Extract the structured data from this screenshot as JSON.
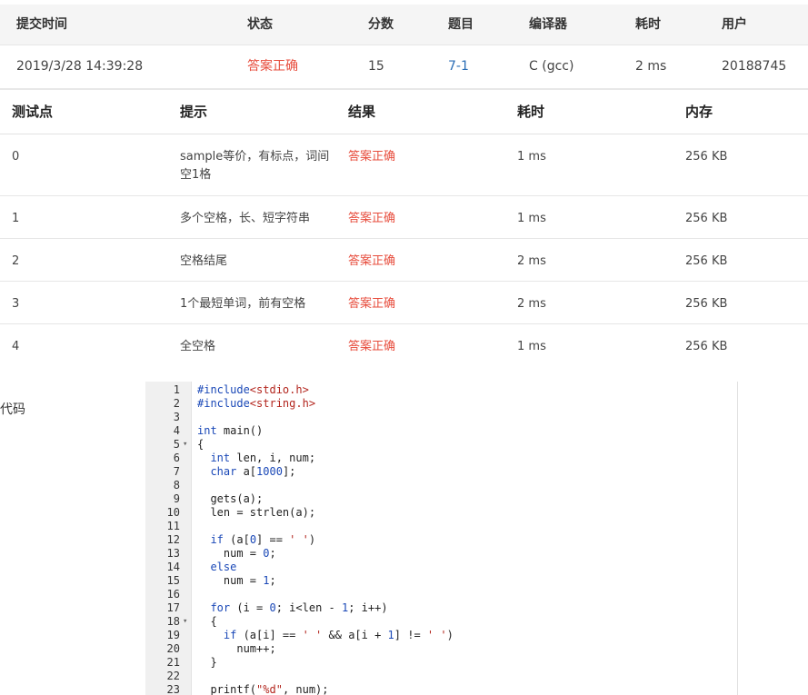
{
  "summary": {
    "headers": {
      "time": "提交时间",
      "status": "状态",
      "score": "分数",
      "problem": "题目",
      "compiler": "编译器",
      "elapsed": "耗时",
      "user": "用户"
    },
    "row": {
      "time": "2019/3/28 14:39:28",
      "status": "答案正确",
      "score": "15",
      "problem": "7-1",
      "compiler": "C (gcc)",
      "elapsed": "2 ms",
      "user": "20188745"
    }
  },
  "cases": {
    "headers": {
      "id": "测试点",
      "hint": "提示",
      "result": "结果",
      "time": "耗时",
      "memory": "内存"
    },
    "rows": [
      {
        "id": "0",
        "hint": "sample等价，有标点，词间空1格",
        "result": "答案正确",
        "time": "1 ms",
        "memory": "256 KB"
      },
      {
        "id": "1",
        "hint": "多个空格，长、短字符串",
        "result": "答案正确",
        "time": "1 ms",
        "memory": "256 KB"
      },
      {
        "id": "2",
        "hint": "空格结尾",
        "result": "答案正确",
        "time": "2 ms",
        "memory": "256 KB"
      },
      {
        "id": "3",
        "hint": "1个最短单词，前有空格",
        "result": "答案正确",
        "time": "2 ms",
        "memory": "256 KB"
      },
      {
        "id": "4",
        "hint": "全空格",
        "result": "答案正确",
        "time": "1 ms",
        "memory": "256 KB"
      }
    ]
  },
  "code": {
    "label": "代码",
    "lines": [
      "#include<stdio.h>",
      "#include<string.h>",
      "",
      "int main()",
      "{",
      "  int len, i, num;",
      "  char a[1000];",
      "",
      "  gets(a);",
      "  len = strlen(a);",
      "",
      "  if (a[0] == ' ')",
      "    num = 0;",
      "  else",
      "    num = 1;",
      "",
      "  for (i = 0; i<len - 1; i++)",
      "  {",
      "    if (a[i] == ' ' && a[i + 1] != ' ')",
      "      num++;",
      "  }",
      "",
      "  printf(\"%d\", num);"
    ],
    "fold_lines": [
      5,
      18
    ]
  },
  "colors": {
    "accepted": "#e74c3c",
    "link": "#2a6db5",
    "header_bg": "#f5f5f5",
    "keyword": "#1a48b7",
    "string": "#b3261e"
  }
}
